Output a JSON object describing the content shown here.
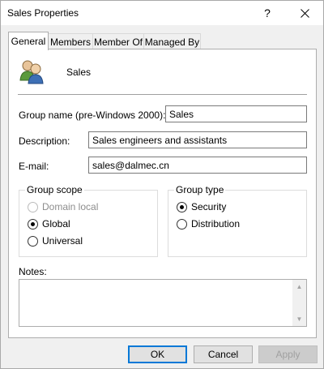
{
  "window": {
    "title": "Sales Properties",
    "help_glyph": "?"
  },
  "tabs": [
    {
      "label": "General"
    },
    {
      "label": "Members"
    },
    {
      "label": "Member Of"
    },
    {
      "label": "Managed By"
    }
  ],
  "general": {
    "group_name": "Sales",
    "fields": {
      "pre_windows_label": "Group name (pre-Windows 2000):",
      "pre_windows_value": "Sales",
      "description_label": "Description:",
      "description_value": "Sales engineers and assistants",
      "email_label": "E-mail:",
      "email_value": "sales@dalmec.cn"
    },
    "group_scope": {
      "title": "Group scope",
      "options": [
        {
          "label": "Domain local",
          "checked": false,
          "disabled": true
        },
        {
          "label": "Global",
          "checked": true,
          "disabled": false
        },
        {
          "label": "Universal",
          "checked": false,
          "disabled": false
        }
      ]
    },
    "group_type": {
      "title": "Group type",
      "options": [
        {
          "label": "Security",
          "checked": true
        },
        {
          "label": "Distribution",
          "checked": false
        }
      ]
    },
    "notes_label": "Notes:",
    "notes_value": ""
  },
  "buttons": {
    "ok": "OK",
    "cancel": "Cancel",
    "apply": "Apply"
  },
  "colors": {
    "accent": "#0078d7",
    "panel": "#ffffff",
    "dialog": "#f0f0f0"
  }
}
